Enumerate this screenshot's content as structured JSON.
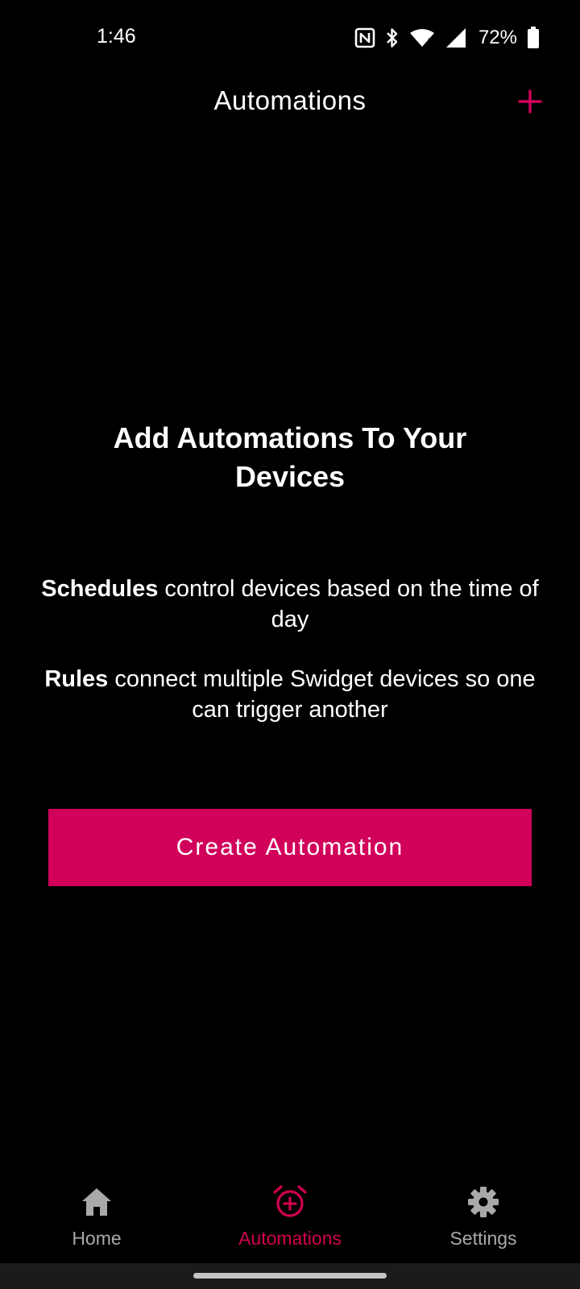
{
  "status_bar": {
    "time": "1:46",
    "battery_percent": "72%",
    "icons": [
      "nfc-icon",
      "bluetooth-icon",
      "wifi-icon",
      "signal-icon",
      "battery-icon"
    ]
  },
  "header": {
    "title": "Automations",
    "add_icon": "plus-icon"
  },
  "empty_state": {
    "headline": "Add Automations To Your Devices",
    "schedules": {
      "term": "Schedules",
      "text": " control devices based on the time of day"
    },
    "rules": {
      "term": "Rules",
      "text": " connect multiple Swidget devices so one can trigger another"
    },
    "button_label": "Create Automation"
  },
  "bottom_nav": {
    "items": [
      {
        "label": "Home",
        "icon": "home-icon",
        "active": false
      },
      {
        "label": "Automations",
        "icon": "alarm-plus-icon",
        "active": true
      },
      {
        "label": "Settings",
        "icon": "gear-icon",
        "active": false
      }
    ]
  },
  "colors": {
    "accent": "#d1005a",
    "active_nav": "#d1004f",
    "inactive_nav": "#a9a9a9",
    "background": "#000000"
  }
}
